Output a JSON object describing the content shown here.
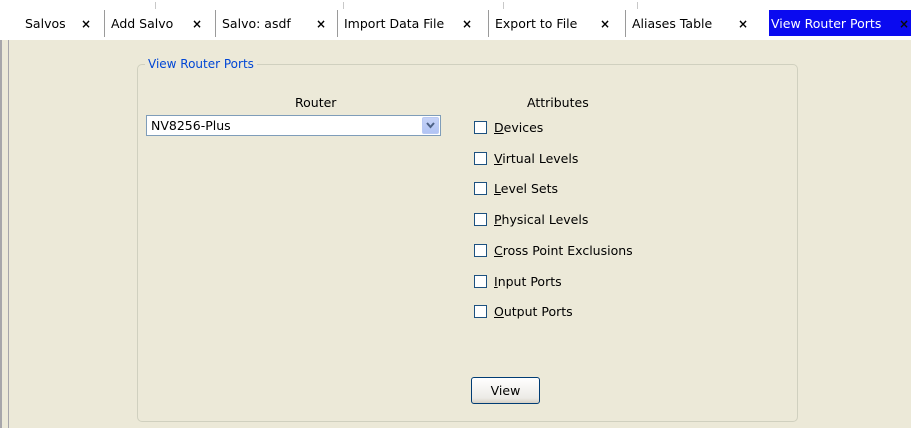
{
  "tabs": [
    {
      "label": "Salvos",
      "close": "×"
    },
    {
      "label": "Add Salvo",
      "close": "×"
    },
    {
      "label": "Salvo: asdf",
      "close": "×"
    },
    {
      "label": "Import Data File",
      "close": "×"
    },
    {
      "label": "Export to File",
      "close": "×"
    },
    {
      "label": "Aliases Table",
      "close": "×"
    },
    {
      "label": "View Router Ports",
      "close": "×",
      "active": true
    }
  ],
  "panel": {
    "title": "View Router Ports",
    "router_label": "Router",
    "router_value": "NV8256-Plus",
    "attributes_label": "Attributes",
    "attributes": [
      {
        "mnemonic": "D",
        "rest": "evices",
        "checked": false
      },
      {
        "mnemonic": "V",
        "rest": "irtual Levels",
        "checked": false
      },
      {
        "mnemonic": "L",
        "rest": "evel Sets",
        "checked": false
      },
      {
        "mnemonic": "P",
        "rest": "hysical Levels",
        "checked": false
      },
      {
        "mnemonic": "C",
        "rest": "ross Point Exclusions",
        "checked": false
      },
      {
        "mnemonic": "I",
        "rest": "nput Ports",
        "checked": false
      },
      {
        "mnemonic": "O",
        "rest": "utput Ports",
        "checked": false
      }
    ],
    "view_button": "View"
  },
  "colors": {
    "active_tab": "#0a0af0",
    "group_title": "#0046d5",
    "background": "#ece9d8"
  }
}
